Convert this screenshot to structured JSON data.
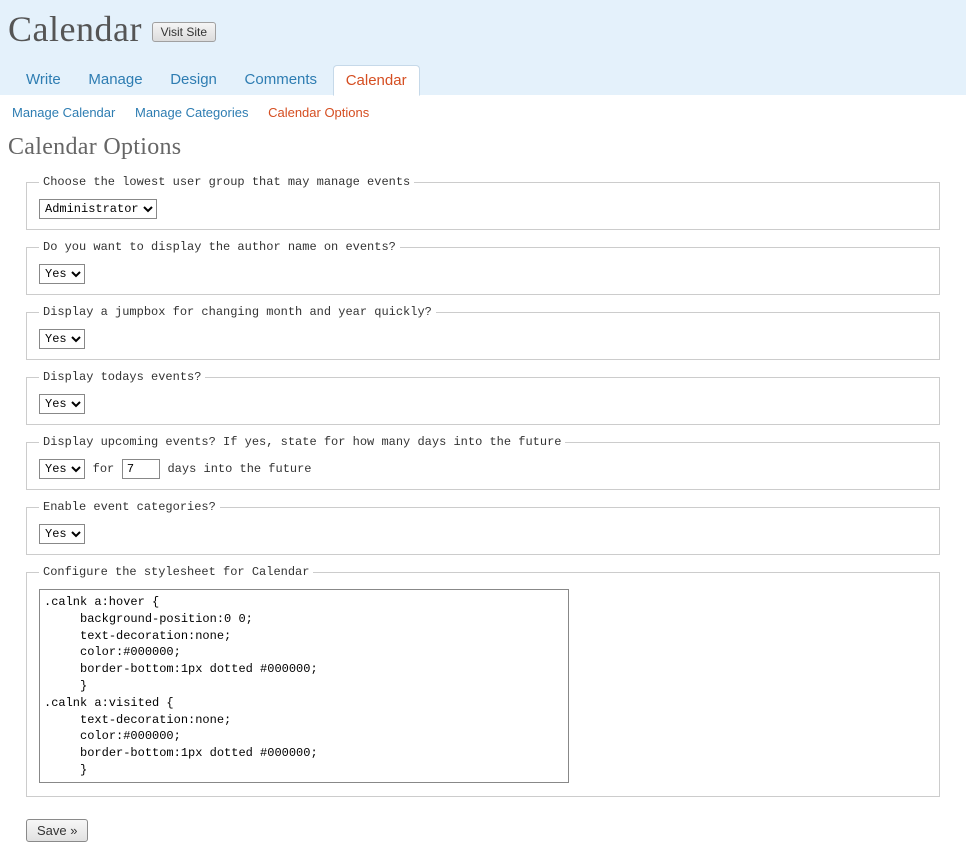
{
  "header": {
    "title": "Calendar",
    "visit_site": "Visit Site"
  },
  "tabs": [
    "Write",
    "Manage",
    "Design",
    "Comments",
    "Calendar"
  ],
  "active_tab": 4,
  "subnav": {
    "items": [
      "Manage Calendar",
      "Manage Categories",
      "Calendar Options"
    ],
    "current": 2
  },
  "page_heading": "Calendar Options",
  "fieldsets": {
    "usergroup": {
      "legend": "Choose the lowest user group that may manage events",
      "value": "Administrator"
    },
    "author": {
      "legend": "Do you want to display the author name on events?",
      "value": "Yes"
    },
    "jumpbox": {
      "legend": "Display a jumpbox for changing month and year quickly?",
      "value": "Yes"
    },
    "todays": {
      "legend": "Display todays events?",
      "value": "Yes"
    },
    "upcoming": {
      "legend": "Display upcoming events? If yes, state for how many days into the future",
      "value": "Yes",
      "for_label": "for",
      "days_value": "7",
      "days_suffix": "days into the future"
    },
    "categories": {
      "legend": "Enable event categories?",
      "value": "Yes"
    },
    "stylesheet": {
      "legend": "Configure the stylesheet for Calendar",
      "value": ".calnk a:hover {\n     background-position:0 0;\n     text-decoration:none;\n     color:#000000;\n     border-bottom:1px dotted #000000;\n     }\n.calnk a:visited {\n     text-decoration:none;\n     color:#000000;\n     border-bottom:1px dotted #000000;\n     }"
    }
  },
  "save_label": "Save »"
}
